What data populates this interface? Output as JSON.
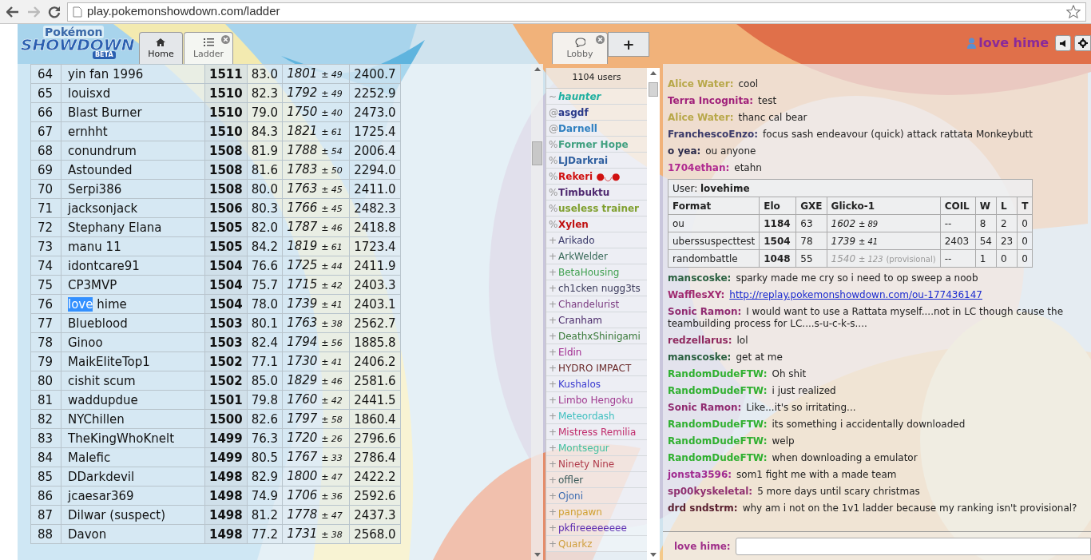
{
  "browser": {
    "url": "play.pokemonshowdown.com/ladder"
  },
  "header": {
    "logo": {
      "top": "Pokémon",
      "main": "SHOWDOWN",
      "badge": "BETA"
    },
    "tabs": [
      {
        "label": "Home",
        "selected": false,
        "closable": false
      },
      {
        "label": "Ladder",
        "selected": true,
        "closable": true
      }
    ],
    "room_tabs": [
      {
        "label": "Lobby",
        "selected": true,
        "closable": true
      }
    ],
    "new_room": {
      "label": "+"
    },
    "user": {
      "name": "love hime"
    }
  },
  "ladder": {
    "rows": [
      {
        "rank": "64",
        "name": "yin fan 1996",
        "elo": "1511",
        "gxe": "83.0",
        "glicko": "1801",
        "deviation": "± 49",
        "coil": "2400.7"
      },
      {
        "rank": "65",
        "name": "louisxd",
        "elo": "1510",
        "gxe": "82.3",
        "glicko": "1792",
        "deviation": "± 49",
        "coil": "2252.9"
      },
      {
        "rank": "66",
        "name": "Blast Burner",
        "elo": "1510",
        "gxe": "79.0",
        "glicko": "1750",
        "deviation": "± 40",
        "coil": "2473.0"
      },
      {
        "rank": "67",
        "name": "ernhht",
        "elo": "1510",
        "gxe": "84.3",
        "glicko": "1821",
        "deviation": "± 61",
        "coil": "1725.4"
      },
      {
        "rank": "68",
        "name": "conundrum",
        "elo": "1508",
        "gxe": "81.9",
        "glicko": "1788",
        "deviation": "± 54",
        "coil": "2006.4"
      },
      {
        "rank": "69",
        "name": "Astounded",
        "elo": "1508",
        "gxe": "81.6",
        "glicko": "1783",
        "deviation": "± 50",
        "coil": "2294.0"
      },
      {
        "rank": "70",
        "name": "Serpi386",
        "elo": "1508",
        "gxe": "80.0",
        "glicko": "1763",
        "deviation": "± 45",
        "coil": "2411.0"
      },
      {
        "rank": "71",
        "name": "jacksonjack",
        "elo": "1506",
        "gxe": "80.3",
        "glicko": "1766",
        "deviation": "± 45",
        "coil": "2482.3"
      },
      {
        "rank": "72",
        "name": "Stephany Elana",
        "elo": "1505",
        "gxe": "82.0",
        "glicko": "1787",
        "deviation": "± 46",
        "coil": "2418.8"
      },
      {
        "rank": "73",
        "name": "manu 11",
        "elo": "1505",
        "gxe": "84.2",
        "glicko": "1819",
        "deviation": "± 61",
        "coil": "1723.4"
      },
      {
        "rank": "74",
        "name": "idontcare91",
        "elo": "1504",
        "gxe": "76.6",
        "glicko": "1725",
        "deviation": "± 44",
        "coil": "2411.9"
      },
      {
        "rank": "75",
        "name": "CP3MVP",
        "elo": "1504",
        "gxe": "75.7",
        "glicko": "1715",
        "deviation": "± 42",
        "coil": "2403.3"
      },
      {
        "rank": "76",
        "name_parts": [
          {
            "text": "love",
            "selected": true
          },
          {
            "text": "hime",
            "selected": false
          }
        ],
        "elo": "1504",
        "gxe": "78.0",
        "glicko": "1739",
        "deviation": "± 41",
        "coil": "2403.1"
      },
      {
        "rank": "77",
        "name": "Blueblood",
        "elo": "1503",
        "gxe": "80.1",
        "glicko": "1763",
        "deviation": "± 38",
        "coil": "2562.7"
      },
      {
        "rank": "78",
        "name": "Ginoo",
        "elo": "1503",
        "gxe": "82.4",
        "glicko": "1794",
        "deviation": "± 56",
        "coil": "1885.8"
      },
      {
        "rank": "79",
        "name": "MaikEliteTop1",
        "elo": "1502",
        "gxe": "77.1",
        "glicko": "1730",
        "deviation": "± 41",
        "coil": "2406.2"
      },
      {
        "rank": "80",
        "name": "cishit scum",
        "elo": "1502",
        "gxe": "85.0",
        "glicko": "1829",
        "deviation": "± 46",
        "coil": "2581.6"
      },
      {
        "rank": "81",
        "name": "waddupdue",
        "elo": "1501",
        "gxe": "79.8",
        "glicko": "1760",
        "deviation": "± 42",
        "coil": "2441.5"
      },
      {
        "rank": "82",
        "name": "NYChillen",
        "elo": "1500",
        "gxe": "82.6",
        "glicko": "1797",
        "deviation": "± 58",
        "coil": "1860.4"
      },
      {
        "rank": "83",
        "name": "TheKingWhoKnelt",
        "elo": "1499",
        "gxe": "76.3",
        "glicko": "1720",
        "deviation": "± 26",
        "coil": "2796.6"
      },
      {
        "rank": "84",
        "name": "Malefic",
        "elo": "1499",
        "gxe": "80.5",
        "glicko": "1767",
        "deviation": "± 33",
        "coil": "2786.4"
      },
      {
        "rank": "85",
        "name": "DDarkdevil",
        "elo": "1498",
        "gxe": "82.9",
        "glicko": "1800",
        "deviation": "± 47",
        "coil": "2422.2"
      },
      {
        "rank": "86",
        "name": "jcaesar369",
        "elo": "1498",
        "gxe": "74.9",
        "glicko": "1706",
        "deviation": "± 36",
        "coil": "2592.6"
      },
      {
        "rank": "87",
        "name": "Dilwar (suspect)",
        "elo": "1498",
        "gxe": "81.2",
        "glicko": "1778",
        "deviation": "± 47",
        "coil": "2437.3"
      },
      {
        "rank": "88",
        "name": "Davon",
        "elo": "1498",
        "gxe": "77.2",
        "glicko": "1731",
        "deviation": "± 38",
        "coil": "2568.0"
      }
    ]
  },
  "userlist": {
    "count": "1104 users",
    "users": [
      {
        "symbol": "~",
        "name": "haunter",
        "color": "#20b0a0",
        "kind": "admin"
      },
      {
        "symbol": "@",
        "name": "asgdf",
        "color": "#2a3a8a",
        "kind": "staff"
      },
      {
        "symbol": "@",
        "name": "Darnell",
        "color": "#3080c0",
        "kind": "staff"
      },
      {
        "symbol": "%",
        "name": "Former Hope",
        "color": "#40a080",
        "kind": "staff"
      },
      {
        "symbol": "%",
        "name": "LJDarkrai",
        "color": "#3060a0",
        "kind": "staff"
      },
      {
        "symbol": "%",
        "name": "Rekeri ●◡●",
        "color": "#d01010",
        "kind": "staff"
      },
      {
        "symbol": "%",
        "name": "Timbuktu",
        "color": "#502a70",
        "kind": "staff"
      },
      {
        "symbol": "%",
        "name": "useless trainer",
        "color": "#80a030",
        "kind": "staff"
      },
      {
        "symbol": "%",
        "name": "Xylen",
        "color": "#c01010",
        "kind": "staff"
      },
      {
        "symbol": "+",
        "name": "Arikado",
        "color": "#3a3a6a",
        "kind": "voice"
      },
      {
        "symbol": "+",
        "name": "ArkWelder",
        "color": "#3a6a5a",
        "kind": "voice"
      },
      {
        "symbol": "+",
        "name": "BetaHousing",
        "color": "#40a050",
        "kind": "voice"
      },
      {
        "symbol": "+",
        "name": "ch1cken nugg3ts",
        "color": "#3a3a5a",
        "kind": "voice"
      },
      {
        "symbol": "+",
        "name": "Chandelurist",
        "color": "#7a3a80",
        "kind": "voice"
      },
      {
        "symbol": "+",
        "name": "Cranham",
        "color": "#4a2a6a",
        "kind": "voice"
      },
      {
        "symbol": "+",
        "name": "DeathxShinigami",
        "color": "#3a7a3a",
        "kind": "voice"
      },
      {
        "symbol": "+",
        "name": "Eldin",
        "color": "#a02a90",
        "kind": "voice"
      },
      {
        "symbol": "+",
        "name": "HYDRO IMPACT",
        "color": "#6a2a2a",
        "kind": "voice"
      },
      {
        "symbol": "+",
        "name": "Kushalos",
        "color": "#3a3ad0",
        "kind": "voice"
      },
      {
        "symbol": "+",
        "name": "Limbo Hengoku",
        "color": "#a03a90",
        "kind": "voice"
      },
      {
        "symbol": "+",
        "name": "Meteordash",
        "color": "#40c0c0",
        "kind": "voice"
      },
      {
        "symbol": "+",
        "name": "Mistress Remilia",
        "color": "#c02a6a",
        "kind": "voice"
      },
      {
        "symbol": "+",
        "name": "Montsegur",
        "color": "#40c0a0",
        "kind": "voice"
      },
      {
        "symbol": "+",
        "name": "Ninety Nine",
        "color": "#b03a4a",
        "kind": "voice"
      },
      {
        "symbol": "+",
        "name": "offler",
        "color": "#3a5a5a",
        "kind": "voice"
      },
      {
        "symbol": "+",
        "name": "Ojoni",
        "color": "#3a6ab0",
        "kind": "voice"
      },
      {
        "symbol": "+",
        "name": "panpawn",
        "color": "#d0a030",
        "kind": "voice"
      },
      {
        "symbol": "+",
        "name": "pkfireeeeeeee",
        "color": "#5a2ab0",
        "kind": "voice"
      },
      {
        "symbol": "+",
        "name": "Quarkz",
        "color": "#d0a040",
        "kind": "voice"
      }
    ]
  },
  "chat": {
    "items": [
      {
        "kind": "message",
        "user": "Alice Water:",
        "color": "#b8a84a",
        "text": "cool"
      },
      {
        "kind": "message",
        "user": "Terra Incognita:",
        "color": "#a0207a",
        "text": "test"
      },
      {
        "kind": "message",
        "user": "Alice Water:",
        "color": "#b8a84a",
        "text": "thanc cal bear"
      },
      {
        "kind": "message",
        "user": "FranchescoEnzo:",
        "color": "#3a3a6a",
        "text": "focus sash endeavour (quick) attack rattata Monkeybutt"
      },
      {
        "kind": "message",
        "user": "o yea:",
        "color": "#2a2a4a",
        "text": "ou anyone"
      },
      {
        "kind": "message",
        "user": "1704ethan:",
        "color": "#b02a90",
        "text": "etahn"
      },
      {
        "kind": "usertable",
        "label": "User:",
        "user": "lovehime",
        "columns": [
          "Format",
          "Elo",
          "GXE",
          "Glicko-1",
          "COIL",
          "W",
          "L",
          "T"
        ],
        "rows": [
          {
            "format": "ou",
            "elo": "1184",
            "gxe": "63",
            "glicko": "1602",
            "deviation": "± 89",
            "coil": "--",
            "w": "8",
            "l": "2",
            "t": "0",
            "provisional": false
          },
          {
            "format": "uberssuspecttest",
            "elo": "1504",
            "gxe": "78",
            "glicko": "1739",
            "deviation": "± 41",
            "coil": "2403",
            "w": "54",
            "l": "23",
            "t": "0",
            "provisional": false
          },
          {
            "format": "randombattle",
            "elo": "1048",
            "gxe": "55",
            "glicko": "1540",
            "deviation": "± 123",
            "note": "(provisional)",
            "coil": "--",
            "w": "1",
            "l": "0",
            "t": "0",
            "provisional": true
          }
        ]
      },
      {
        "kind": "message",
        "user": "manscoske:",
        "color": "#2a6040",
        "text": "sparky made me cry so i need to op sweep a noob"
      },
      {
        "kind": "link",
        "user": "WafflesXY:",
        "color": "#a02a70",
        "text": "http://replay.pokemonshowdown.com/ou-177436147"
      },
      {
        "kind": "message",
        "user": "Sonic Ramon:",
        "color": "#902a70",
        "text": "I would want to use a Rattata myself....not in LC though cause the teambuilding process for LC....s-u-c-k-s...."
      },
      {
        "kind": "message",
        "user": "redzellarus:",
        "color": "#902a60",
        "text": "lol"
      },
      {
        "kind": "message",
        "user": "manscoske:",
        "color": "#2a6040",
        "text": "get at me"
      },
      {
        "kind": "message",
        "user": "RandomDudeFTW:",
        "color": "#30b030",
        "text": "Oh shit"
      },
      {
        "kind": "message",
        "user": "RandomDudeFTW:",
        "color": "#30b030",
        "text": "i just realized"
      },
      {
        "kind": "message",
        "user": "Sonic Ramon:",
        "color": "#902a70",
        "text": "Like...it's so irritating..."
      },
      {
        "kind": "message",
        "user": "RandomDudeFTW:",
        "color": "#30b030",
        "text": "its something i accidentally downloaded"
      },
      {
        "kind": "message",
        "user": "RandomDudeFTW:",
        "color": "#30b030",
        "text": "welp"
      },
      {
        "kind": "message",
        "user": "RandomDudeFTW:",
        "color": "#30b030",
        "text": "when downloading a emulator"
      },
      {
        "kind": "message",
        "user": "jonsta3596:",
        "color": "#a02a90",
        "text": "som1 fight me with a made team"
      },
      {
        "kind": "message",
        "user": "sp00kyskeletal:",
        "color": "#903070",
        "text": "5 more days until scary christmas"
      },
      {
        "kind": "message",
        "user": "drd sndstrm:",
        "color": "#5a2030",
        "text": "why am i not on the 1v1 ladder because my ranking isn't provisional?"
      }
    ],
    "input": {
      "label": "love hime:"
    }
  }
}
